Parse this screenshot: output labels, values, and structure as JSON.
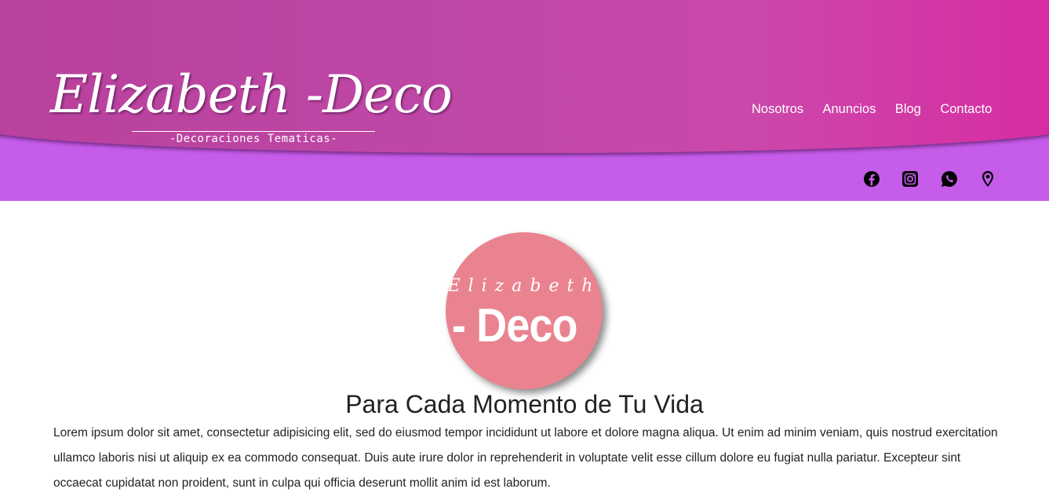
{
  "header": {
    "brand": "Elizabeth -Deco",
    "tagline": "-Decoraciones Tematicas-",
    "colors": {
      "header_pink": "#bf47a6",
      "topbar_purple": "#c55cea"
    }
  },
  "nav": {
    "items": [
      {
        "label": "Nosotros"
      },
      {
        "label": "Anuncios"
      },
      {
        "label": "Blog"
      },
      {
        "label": "Contacto"
      }
    ]
  },
  "social": {
    "icons": [
      "facebook-icon",
      "instagram-icon",
      "whatsapp-icon",
      "location-pin-icon"
    ]
  },
  "hero": {
    "logo_top": "Elizabeth",
    "logo_bottom": "- Deco",
    "logo_color": "#ea8390",
    "headline": "Para Cada Momento de Tu Vida",
    "paragraph": "Lorem ipsum dolor sit amet, consectetur adipisicing elit, sed do eiusmod tempor incididunt ut labore et dolore magna aliqua. Ut enim ad minim veniam, quis nostrud exercitation ullamco laboris nisi ut aliquip ex ea commodo consequat. Duis aute irure dolor in reprehenderit in voluptate velit esse cillum dolore eu fugiat nulla pariatur. Excepteur sint occaecat cupidatat non proident, sunt in culpa qui officia deserunt mollit anim id est laborum."
  }
}
